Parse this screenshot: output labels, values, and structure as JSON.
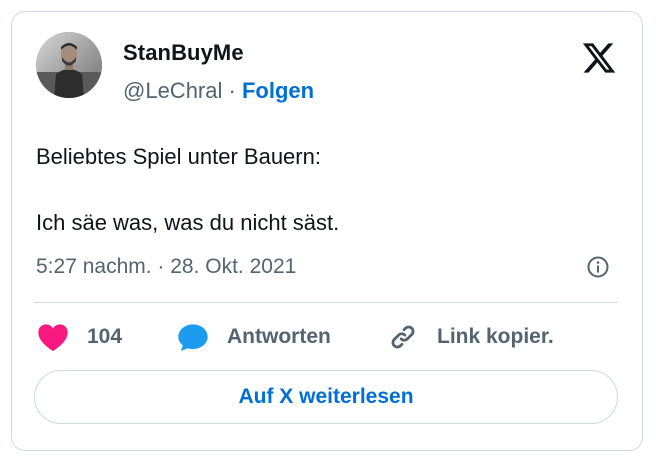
{
  "tweet": {
    "author_name": "StanBuyMe",
    "handle": "@LeChral",
    "separator": " · ",
    "follow_label": "Folgen",
    "text_line1": "Beliebtes Spiel unter Bauern:",
    "text_line2": "Ich säe was, was du nicht säst.",
    "timestamp": "5:27 nachm. · 28. Okt. 2021"
  },
  "actions": {
    "like_count": "104",
    "reply_label": "Antworten",
    "copy_link_label": "Link kopier."
  },
  "footer": {
    "read_more_label": "Auf X weiterlesen"
  },
  "colors": {
    "like": "#f91880",
    "reply": "#1d9bf0",
    "link": "#006fd6",
    "muted": "#536471",
    "border": "#cfd9de"
  }
}
